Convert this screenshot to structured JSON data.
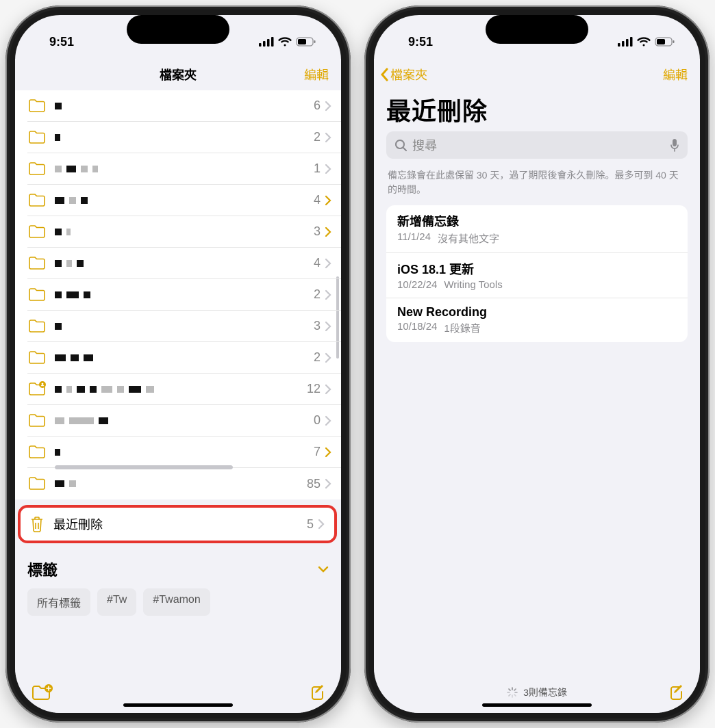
{
  "status": {
    "time": "9:51"
  },
  "left": {
    "nav_title": "檔案夾",
    "edit": "編輯",
    "folders": [
      {
        "count": 6,
        "chev": "gray",
        "shared": false,
        "locked": null
      },
      {
        "count": 2,
        "chev": "gray",
        "shared": false,
        "locked": null
      },
      {
        "count": 1,
        "chev": "gray",
        "shared": false,
        "locked": null
      },
      {
        "count": 4,
        "chev": "gold",
        "shared": false,
        "locked": null
      },
      {
        "count": 3,
        "chev": "gold",
        "shared": false,
        "locked": null
      },
      {
        "count": 4,
        "chev": "gray",
        "shared": false,
        "locked": null
      },
      {
        "count": 2,
        "chev": "gray",
        "shared": false,
        "locked": null
      },
      {
        "count": 3,
        "chev": "gray",
        "shared": false,
        "locked": null
      },
      {
        "count": 2,
        "chev": "gray",
        "shared": false,
        "locked": null
      },
      {
        "count": 12,
        "chev": "gray",
        "shared": true,
        "locked": null
      },
      {
        "count": 0,
        "chev": "gray",
        "shared": false,
        "locked": null
      },
      {
        "count": 7,
        "chev": "gold",
        "shared": false,
        "locked": 260
      },
      {
        "count": 85,
        "chev": "gray",
        "shared": false,
        "locked": null
      }
    ],
    "recently_deleted": {
      "label": "最近刪除",
      "count": 5
    },
    "tags_title": "標籤",
    "tags": [
      "所有標籤",
      "#Tw",
      "#Twamon"
    ]
  },
  "right": {
    "back": "檔案夾",
    "edit": "編輯",
    "title": "最近刪除",
    "search_placeholder": "搜尋",
    "explain": "備忘錄會在此處保留 30 天，過了期限後會永久刪除。最多可到 40 天的時間。",
    "notes": [
      {
        "title": "新增備忘錄",
        "date": "11/1/24",
        "sub": "沒有其他文字"
      },
      {
        "title": "iOS 18.1 更新",
        "date": "10/22/24",
        "sub": "Writing Tools"
      },
      {
        "title": "New Recording",
        "date": "10/18/24",
        "sub": "1段錄音"
      }
    ],
    "footer_text": "3則備忘錄"
  }
}
